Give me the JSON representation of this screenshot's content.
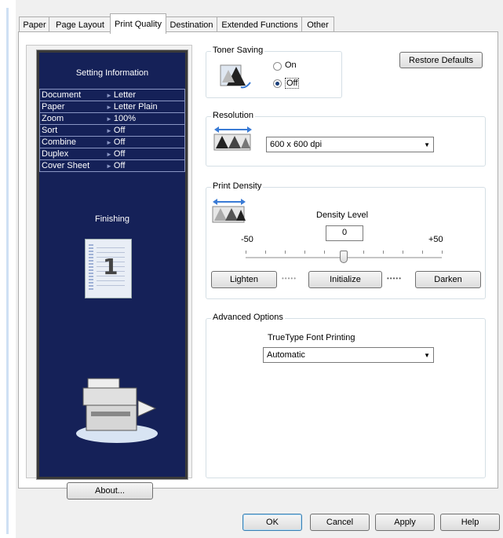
{
  "tabs": [
    "Paper",
    "Page Layout",
    "Print Quality",
    "Destination",
    "Extended Functions",
    "Other"
  ],
  "active_tab": "Print Quality",
  "preview": {
    "setting_info_title": "Setting Information",
    "rows": [
      {
        "key": "Document",
        "value": "Letter"
      },
      {
        "key": "Paper",
        "value": "Letter Plain"
      },
      {
        "key": "Zoom",
        "value": "100%"
      },
      {
        "key": "Sort",
        "value": "Off"
      },
      {
        "key": "Combine",
        "value": "Off"
      },
      {
        "key": "Duplex",
        "value": "Off"
      },
      {
        "key": "Cover Sheet",
        "value": "Off"
      }
    ],
    "finishing_label": "Finishing",
    "page_number": "1"
  },
  "about_button": "About...",
  "toner_saving": {
    "label": "Toner Saving",
    "on_label": "On",
    "off_label": "Off",
    "selected": "Off"
  },
  "restore_defaults": "Restore Defaults",
  "resolution": {
    "label": "Resolution",
    "value": "600 x 600 dpi"
  },
  "print_density": {
    "label": "Print Density",
    "density_level_label": "Density Level",
    "value": "0",
    "min_label": "-50",
    "max_label": "+50",
    "slider_value": 0,
    "lighten": "Lighten",
    "initialize": "Initialize",
    "darken": "Darken"
  },
  "advanced": {
    "label": "Advanced Options",
    "truetype_label": "TrueType Font Printing",
    "truetype_value": "Automatic"
  },
  "dialog_buttons": {
    "ok": "OK",
    "cancel": "Cancel",
    "apply": "Apply",
    "help": "Help"
  }
}
